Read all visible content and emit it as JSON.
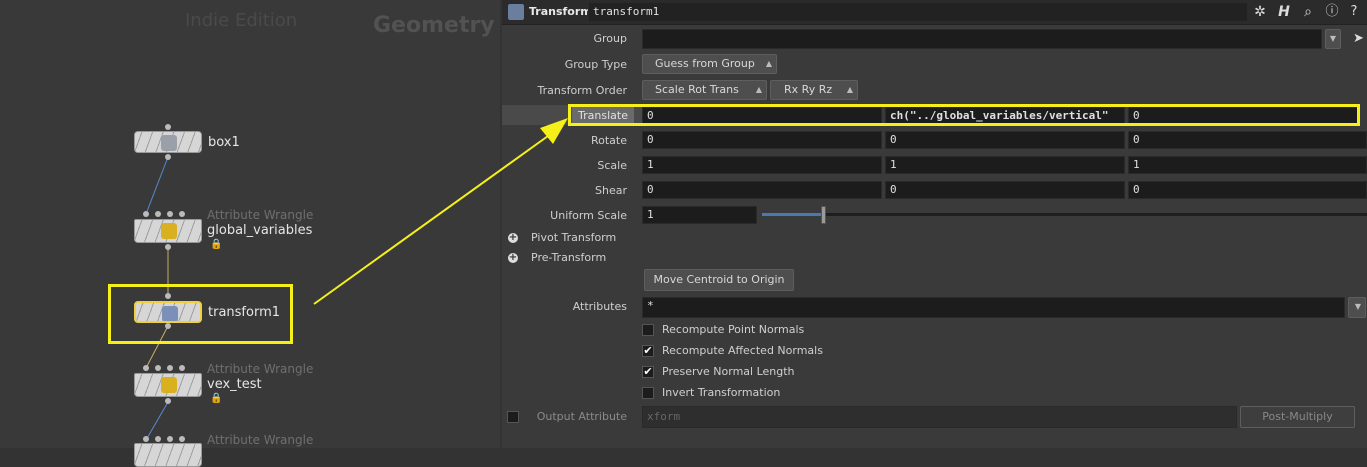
{
  "network": {
    "watermark_edition": "Indie Edition",
    "watermark_context": "Geometry",
    "nodes": [
      {
        "name": "box1",
        "type": ""
      },
      {
        "name": "global_variables",
        "type": "Attribute Wrangle"
      },
      {
        "name": "transform1",
        "type": ""
      },
      {
        "name": "vex_test",
        "type": "Attribute Wrangle"
      },
      {
        "name": "",
        "type": "Attribute Wrangle"
      }
    ]
  },
  "params": {
    "header": {
      "node_type": "Transform",
      "node_name": "transform1"
    },
    "group": {
      "label": "Group",
      "value": ""
    },
    "group_type": {
      "label": "Group Type",
      "value": "Guess from Group"
    },
    "transform_order": {
      "label": "Transform Order",
      "value": "Scale Rot Trans",
      "value2": "Rx Ry Rz"
    },
    "translate": {
      "label": "Translate",
      "x": "0",
      "y": "ch(\"../global_variables/vertical\"",
      "z": "0"
    },
    "rotate": {
      "label": "Rotate",
      "x": "0",
      "y": "0",
      "z": "0"
    },
    "scale": {
      "label": "Scale",
      "x": "1",
      "y": "1",
      "z": "1"
    },
    "shear": {
      "label": "Shear",
      "x": "0",
      "y": "0",
      "z": "0"
    },
    "uniform_scale": {
      "label": "Uniform Scale",
      "value": "1",
      "slider_fraction": 0.1
    },
    "pivot_transform": {
      "label": "Pivot Transform"
    },
    "pre_transform": {
      "label": "Pre-Transform"
    },
    "move_centroid": {
      "label": "Move Centroid to Origin"
    },
    "attributes": {
      "label": "Attributes",
      "value": "*"
    },
    "checkboxes": [
      {
        "label": "Recompute Point Normals",
        "checked": false
      },
      {
        "label": "Recompute Affected Normals",
        "checked": true
      },
      {
        "label": "Preserve Normal Length",
        "checked": true
      },
      {
        "label": "Invert Transformation",
        "checked": false
      }
    ],
    "output_attribute": {
      "label": "Output Attribute",
      "placeholder": "xform",
      "mode": "Post-Multiply"
    }
  },
  "colors": {
    "highlight": "#f5f019",
    "network_bg": "#393939",
    "params_bg": "#3a3a3a"
  },
  "icons": {
    "gear": "gear-icon",
    "help": "help-icon",
    "search": "search-icon",
    "info": "info-icon",
    "houdini": "houdini-h-icon"
  }
}
